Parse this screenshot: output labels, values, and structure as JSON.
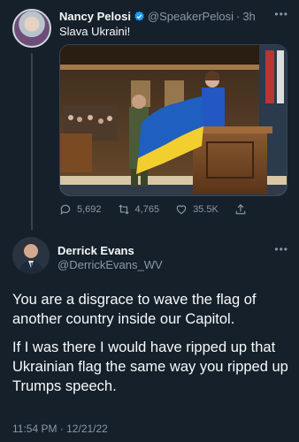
{
  "tweet1": {
    "name": "Nancy Pelosi",
    "handle": "@SpeakerPelosi",
    "separator": "·",
    "time": "3h",
    "text": "Slava Ukraini!",
    "replies": "5,692",
    "retweets": "4,765",
    "likes": "35.5K"
  },
  "tweet2": {
    "name": "Derrick Evans",
    "handle": "@DerrickEvans_WV",
    "paragraph1": "You are a disgrace to wave the flag of another country inside our Capitol.",
    "paragraph2": "If I was there I would have ripped up that Ukrainian flag the same way you ripped up Trumps speech.",
    "timestamp": "11:54 PM · 12/21/22"
  },
  "icons": {
    "more": "more-icon",
    "verified": "verified-badge-icon",
    "reply": "reply-icon",
    "retweet": "retweet-icon",
    "like": "like-icon",
    "share": "share-icon"
  },
  "colors": {
    "background": "#15202b",
    "text": "#f7f9f9",
    "muted": "#8b98a5",
    "verified": "#1d9bf0",
    "flag_blue": "#1f5fbf",
    "flag_yellow": "#f2cf2f"
  }
}
